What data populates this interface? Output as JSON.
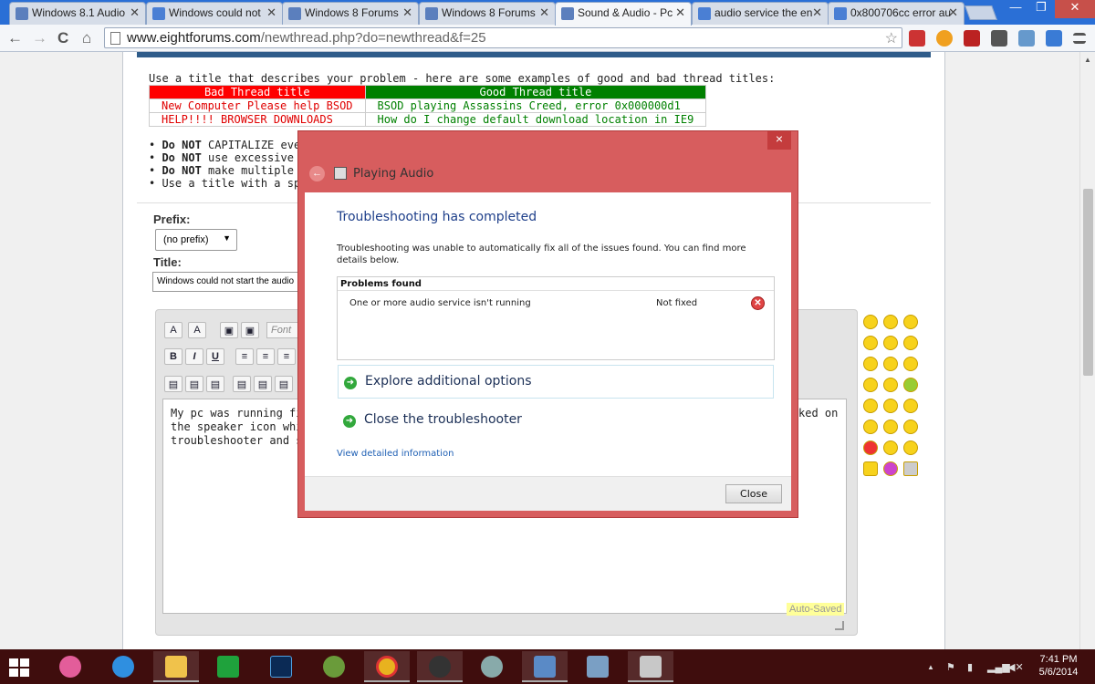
{
  "browser": {
    "tabs": [
      {
        "label": "Windows 8.1 Audio",
        "color": "#5b7fbd"
      },
      {
        "label": "Windows could not",
        "color": "#4a7fd4"
      },
      {
        "label": "Windows 8 Forums",
        "color": "#5b7fbd"
      },
      {
        "label": "Windows 8 Forums",
        "color": "#5b7fbd"
      },
      {
        "label": "Sound & Audio - Pc",
        "color": "#5b7fbd"
      },
      {
        "label": "audio service the en",
        "color": "#4a7fd4"
      },
      {
        "label": "0x800706cc error au",
        "color": "#4a7fd4"
      }
    ],
    "url_domain": "www.eightforums.com",
    "url_path": "/newthread.php?do=newthread&f=25"
  },
  "page": {
    "intro": "Use a title that describes your problem - here are some examples of good and bad thread titles:",
    "bad_header": "Bad Thread title",
    "good_header": "Good Thread title",
    "examples": [
      {
        "bad": "New Computer Please help BSOD",
        "good": "BSOD playing Assassins Creed, error 0x000000d1"
      },
      {
        "bad": "HELP!!!! BROWSER DOWNLOADS",
        "good": "How do I change default download location in IE9"
      }
    ],
    "rules": [
      {
        "bold": "Do NOT",
        "rest": " CAPITALIZE eve"
      },
      {
        "bold": "Do NOT",
        "rest": " use excessive s"
      },
      {
        "bold": "Do NOT",
        "rest": " make multiple th"
      },
      {
        "bold": "",
        "rest": "Use a title with a specifi"
      }
    ],
    "prefix_label": "Prefix:",
    "prefix_value": "(no prefix)",
    "title_label": "Title:",
    "title_value": "Windows could not start the audio",
    "font_placeholder": "Font",
    "editor_lines": [
      "My pc was running fine",
      "the speaker icon which",
      "troubleshooter and sta"
    ],
    "editor_overflow": "ked on",
    "autosaved": "Auto-Saved"
  },
  "dialog": {
    "title": "Playing Audio",
    "close_glyph": "×",
    "heading": "Troubleshooting has completed",
    "description": "Troubleshooting was unable to automatically fix all of the issues found. You can find more details below.",
    "problems_header": "Problems found",
    "problem_name": "One or more audio service isn't running",
    "problem_status": "Not fixed",
    "option_explore": "Explore additional options",
    "option_close": "Close the troubleshooter",
    "detail_link": "View detailed information",
    "close_button": "Close"
  },
  "taskbar": {
    "time": "7:41 PM",
    "date": "5/6/2014",
    "tray_arrow": "▲"
  },
  "icons": {
    "back": "←",
    "forward": "→",
    "reload": "C",
    "home": "⌂",
    "star": "☆",
    "minimize": "—",
    "maximize": "❐",
    "window_close": "✕",
    "green_arrow": "➜",
    "error_x": "✕",
    "dialog_back": "←"
  }
}
